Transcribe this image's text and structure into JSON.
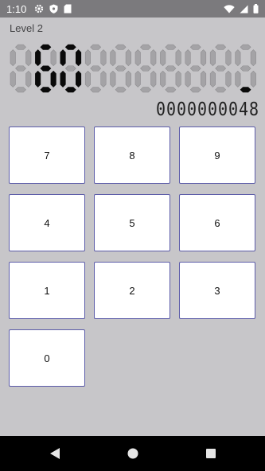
{
  "status_bar": {
    "time": "1:10",
    "icons_left": [
      "gear-icon",
      "shield-icon",
      "sd-card-icon"
    ],
    "icons_right": [
      "wifi-icon",
      "signal-icon",
      "battery-icon"
    ]
  },
  "level": {
    "label": "Level 2"
  },
  "display": {
    "digits": [
      "",
      "6",
      "0",
      "",
      "",
      "",
      "",
      "",
      "",
      "_"
    ],
    "active_color": "#0a0a0a",
    "ghost_color": "#a4a3a6"
  },
  "counter": {
    "digits": [
      "0",
      "0",
      "0",
      "0",
      "0",
      "0",
      "0",
      "0",
      "4",
      "8"
    ]
  },
  "keypad": {
    "keys": [
      "7",
      "8",
      "9",
      "4",
      "5",
      "6",
      "1",
      "2",
      "3",
      "0"
    ],
    "border_color": "#5b5ba8"
  },
  "nav_bar": {
    "buttons": [
      "back-icon",
      "home-icon",
      "recents-icon"
    ]
  }
}
